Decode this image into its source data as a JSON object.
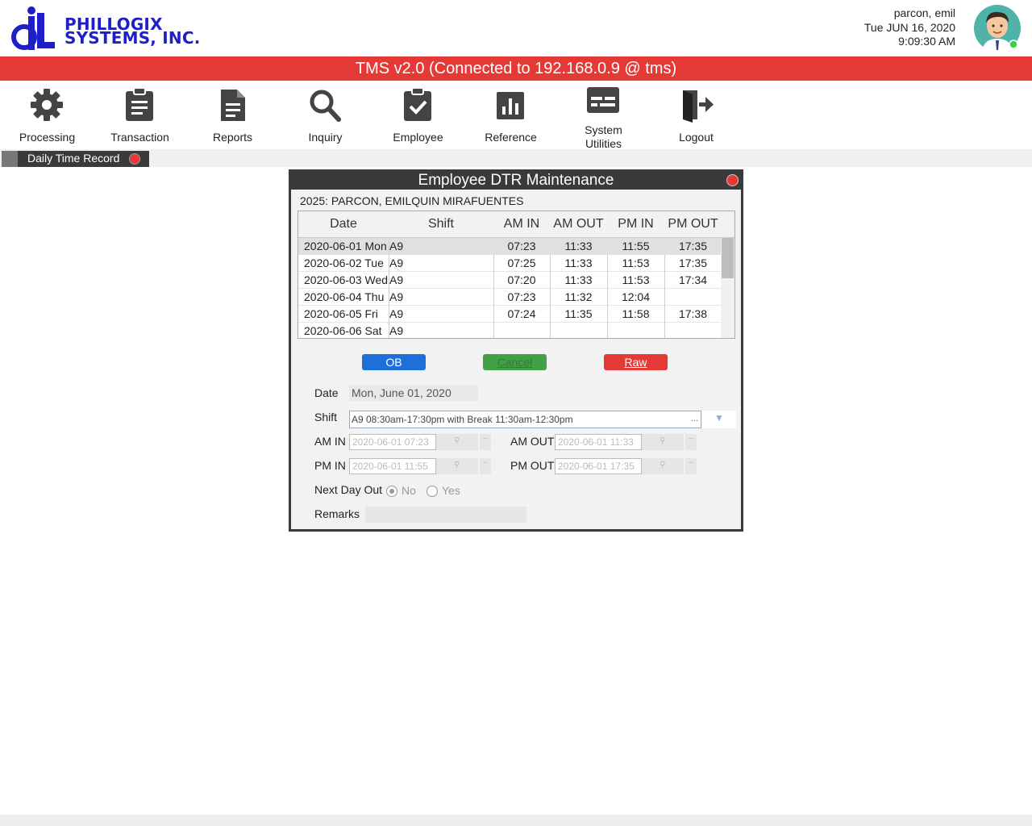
{
  "header": {
    "company_line1": "PHILLOGIX",
    "company_line2": "SYSTEMS, INC.",
    "user": "parcon, emil",
    "date": "Tue JUN 16, 2020",
    "time": "9:09:30 AM"
  },
  "title": "TMS v2.0 (Connected to 192.168.0.9 @ tms)",
  "toolbar": [
    {
      "label": "Processing",
      "icon": "gear-icon"
    },
    {
      "label": "Transaction",
      "icon": "clipboard-icon"
    },
    {
      "label": "Reports",
      "icon": "document-icon"
    },
    {
      "label": "Inquiry",
      "icon": "search-icon"
    },
    {
      "label": "Employee",
      "icon": "clipboard-check-icon"
    },
    {
      "label": "Reference",
      "icon": "bar-chart-icon"
    },
    {
      "label": "System Utilities",
      "icon": "keyboard-icon"
    },
    {
      "label": "Logout",
      "icon": "exit-door-icon"
    }
  ],
  "tab": {
    "label": "Daily Time Record"
  },
  "dialog": {
    "title": "Employee DTR Maintenance",
    "employee": "2025: PARCON, EMILQUIN MIRAFUENTES",
    "columns": [
      "Date",
      "Shift",
      "AM IN",
      "AM OUT",
      "PM IN",
      "PM OUT"
    ],
    "rows": [
      {
        "date": "2020-06-01 Mon",
        "shift": "A9",
        "am_in": "07:23",
        "am_out": "11:33",
        "pm_in": "11:55",
        "pm_out": "17:35"
      },
      {
        "date": "2020-06-02 Tue",
        "shift": "A9",
        "am_in": "07:25",
        "am_out": "11:33",
        "pm_in": "11:53",
        "pm_out": "17:35"
      },
      {
        "date": "2020-06-03 Wed",
        "shift": "A9",
        "am_in": "07:20",
        "am_out": "11:33",
        "pm_in": "11:53",
        "pm_out": "17:34"
      },
      {
        "date": "2020-06-04 Thu",
        "shift": "A9",
        "am_in": "07:23",
        "am_out": "11:32",
        "pm_in": "12:04",
        "pm_out": ""
      },
      {
        "date": "2020-06-05 Fri",
        "shift": "A9",
        "am_in": "07:24",
        "am_out": "11:35",
        "pm_in": "11:58",
        "pm_out": "17:38"
      },
      {
        "date": "2020-06-06 Sat",
        "shift": "A9",
        "am_in": "",
        "am_out": "",
        "pm_in": "",
        "pm_out": ""
      }
    ],
    "buttons": {
      "ob": "OB",
      "cancel": "Cancel",
      "raw": "Raw"
    },
    "form": {
      "date_label": "Date",
      "date_value": "Mon, June 01, 2020",
      "shift_label": "Shift",
      "shift_value": "A9 08:30am-17:30pm with Break 11:30am-12:30pm",
      "shift_more": "...",
      "am_in_label": "AM IN",
      "am_in_value": "2020-06-01 07:23",
      "am_out_label": "AM OUT",
      "am_out_value": "2020-06-01 11:33",
      "pm_in_label": "PM IN",
      "pm_in_value": "2020-06-01 11:55",
      "pm_out_label": "PM OUT",
      "pm_out_value": "2020-06-01 17:35",
      "next_day_label": "Next Day Out",
      "no_label": "No",
      "yes_label": "Yes",
      "remarks_label": "Remarks"
    }
  },
  "colors": {
    "accent_red": "#e53935",
    "ob_blue": "#1e6fd9",
    "cancel_green": "#43a047",
    "dark": "#3a3a3a"
  }
}
